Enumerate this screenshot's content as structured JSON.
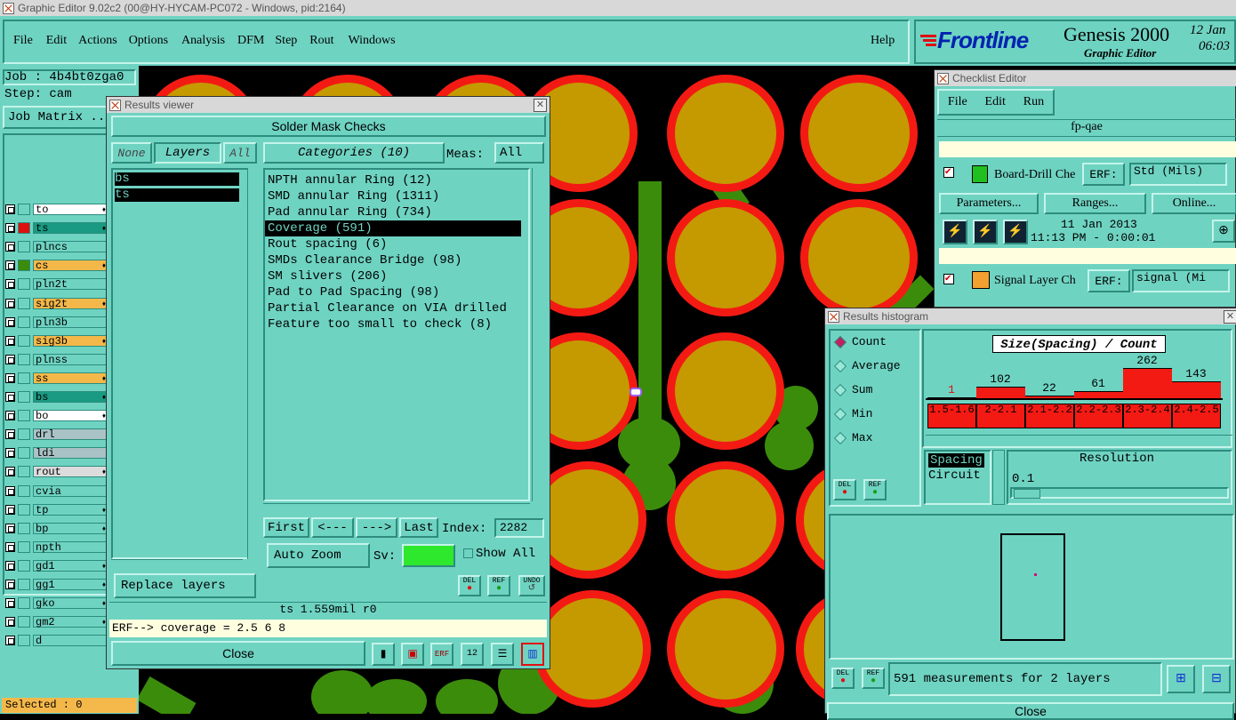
{
  "window_title": "Graphic Editor 9.02c2 (00@HY-HYCAM-PC072 - Windows, pid:2164)",
  "menu": [
    "File",
    "Edit",
    "Actions",
    "Options",
    "Analysis",
    "DFM",
    "Step",
    "Rout",
    "Windows"
  ],
  "help": "Help",
  "brand": {
    "logo": "Frontline",
    "product": "Genesis 2000",
    "subtitle": "Graphic Editor",
    "date": "12 Jan",
    "time": "06:03"
  },
  "job": {
    "job_label": "Job : 4b4bt0zga0",
    "step_label": "Step: cam",
    "matrix": "Job Matrix ..."
  },
  "layers": [
    {
      "name": "to",
      "color": "#ffffff",
      "swatch": "#6fd3c2",
      "mark": "♦"
    },
    {
      "name": "ts",
      "color": "#1a9a82",
      "swatch": "#e01010",
      "mark": "♦",
      "sw_left": "#1030d0"
    },
    {
      "name": "plncs",
      "color": "#6fd3c2",
      "swatch": "#6fd3c2",
      "mark": ""
    },
    {
      "name": "cs",
      "color": "#f4b84a",
      "swatch": "#3c8c0c",
      "mark": "♦"
    },
    {
      "name": "pln2t",
      "color": "#6fd3c2",
      "swatch": "#6fd3c2",
      "mark": ""
    },
    {
      "name": "sig2t",
      "color": "#f4b84a",
      "swatch": "#6fd3c2",
      "mark": "♦"
    },
    {
      "name": "pln3b",
      "color": "#6fd3c2",
      "swatch": "#6fd3c2",
      "mark": ""
    },
    {
      "name": "sig3b",
      "color": "#f4b84a",
      "swatch": "#6fd3c2",
      "mark": "♦"
    },
    {
      "name": "plnss",
      "color": "#6fd3c2",
      "swatch": "#6fd3c2",
      "mark": ""
    },
    {
      "name": "ss",
      "color": "#f4b84a",
      "swatch": "#6fd3c2",
      "mark": "♦"
    },
    {
      "name": "bs",
      "color": "#1a9a82",
      "swatch": "#6fd3c2",
      "mark": "♦"
    },
    {
      "name": "bo",
      "color": "#ffffff",
      "swatch": "#6fd3c2",
      "mark": "♦"
    },
    {
      "name": "drl",
      "color": "#a9c2c6",
      "swatch": "#6fd3c2",
      "mark": ""
    },
    {
      "name": "ldi",
      "color": "#a9c2c6",
      "swatch": "#6fd3c2",
      "mark": ""
    },
    {
      "name": "rout",
      "color": "#dcdcdc",
      "swatch": "#6fd3c2",
      "mark": "♦"
    },
    {
      "name": "cvia",
      "color": "#6fd3c2",
      "swatch": "#6fd3c2",
      "mark": ""
    },
    {
      "name": "tp",
      "color": "#6fd3c2",
      "swatch": "#6fd3c2",
      "mark": "♦"
    },
    {
      "name": "bp",
      "color": "#6fd3c2",
      "swatch": "#6fd3c2",
      "mark": "♦"
    },
    {
      "name": "npth",
      "color": "#6fd3c2",
      "swatch": "#6fd3c2",
      "mark": ""
    },
    {
      "name": "gd1",
      "color": "#6fd3c2",
      "swatch": "#6fd3c2",
      "mark": "♦"
    },
    {
      "name": "gg1",
      "color": "#6fd3c2",
      "swatch": "#6fd3c2",
      "mark": "♦"
    },
    {
      "name": "gko",
      "color": "#6fd3c2",
      "swatch": "#6fd3c2",
      "mark": "♦"
    },
    {
      "name": "gm2",
      "color": "#6fd3c2",
      "swatch": "#6fd3c2",
      "mark": "♦"
    },
    {
      "name": "d",
      "color": "#6fd3c2",
      "swatch": "#6fd3c2",
      "mark": ""
    }
  ],
  "selected": "Selected : 0",
  "results_viewer": {
    "title": "Results viewer",
    "header": "Solder Mask Checks",
    "none": "None",
    "layers_btn": "Layers",
    "all": "All",
    "layer_items": [
      "bs",
      "ts"
    ],
    "categories_btn": "Categories (10)",
    "meas_label": "Meas:",
    "meas_value": "All",
    "categories": [
      "NPTH annular Ring (12)",
      "SMD annular Ring (1311)",
      "Pad annular Ring (734)",
      "Coverage (591)",
      "Rout spacing (6)",
      "SMDs Clearance Bridge (98)",
      "SM slivers (206)",
      "Pad to Pad Spacing (98)",
      "Partial Clearance on VIA drilled",
      "Feature too small to check (8)"
    ],
    "selected_category": 3,
    "nav": {
      "first": "First",
      "prev": "<---",
      "next": "--->",
      "last": "Last",
      "index_label": "Index:",
      "index_value": "2282"
    },
    "zoom": "Auto Zoom",
    "sv_label": "Sv:",
    "show_all": "Show All",
    "replace": "Replace layers",
    "del": "DEL",
    "ref": "REF",
    "undo": "UNDO",
    "status": "ts 1.559mil  r0",
    "erf": "ERF--> coverage = 2.5 6 8",
    "close": "Close"
  },
  "checklist": {
    "title": "Checklist Editor",
    "menu": [
      "File",
      "Edit",
      "Run"
    ],
    "name": "fp-qae",
    "row1_label": "Board-Drill Che",
    "erf_label": "ERF:",
    "row1_erf": "Std (Mils)",
    "params": "Parameters...",
    "ranges": "Ranges...",
    "online": "Online...",
    "run_date": "11 Jan 2013",
    "run_time": "11:13 PM - 0:00:01",
    "row2_label": "Signal Layer Ch",
    "row2_erf": "signal (Mi"
  },
  "histogram": {
    "title": "Results histogram",
    "modes": [
      "Count",
      "Average",
      "Sum",
      "Min",
      "Max"
    ],
    "chart_title": "Size(Spacing) / Count",
    "del": "DEL",
    "ref": "REF",
    "attr_items": [
      "Spacing",
      "Circuit"
    ],
    "resolution_label": "Resolution",
    "resolution_value": "0.1",
    "summary": "591 measurements for 2 layers",
    "close": "Close"
  },
  "chart_data": {
    "type": "bar",
    "title": "Size(Spacing) / Count",
    "categories": [
      "1.5-1.6",
      "2-2.1",
      "2.1-2.2",
      "2.2-2.3",
      "2.3-2.4",
      "2.4-2.5"
    ],
    "values": [
      1,
      102,
      22,
      61,
      262,
      143
    ]
  }
}
